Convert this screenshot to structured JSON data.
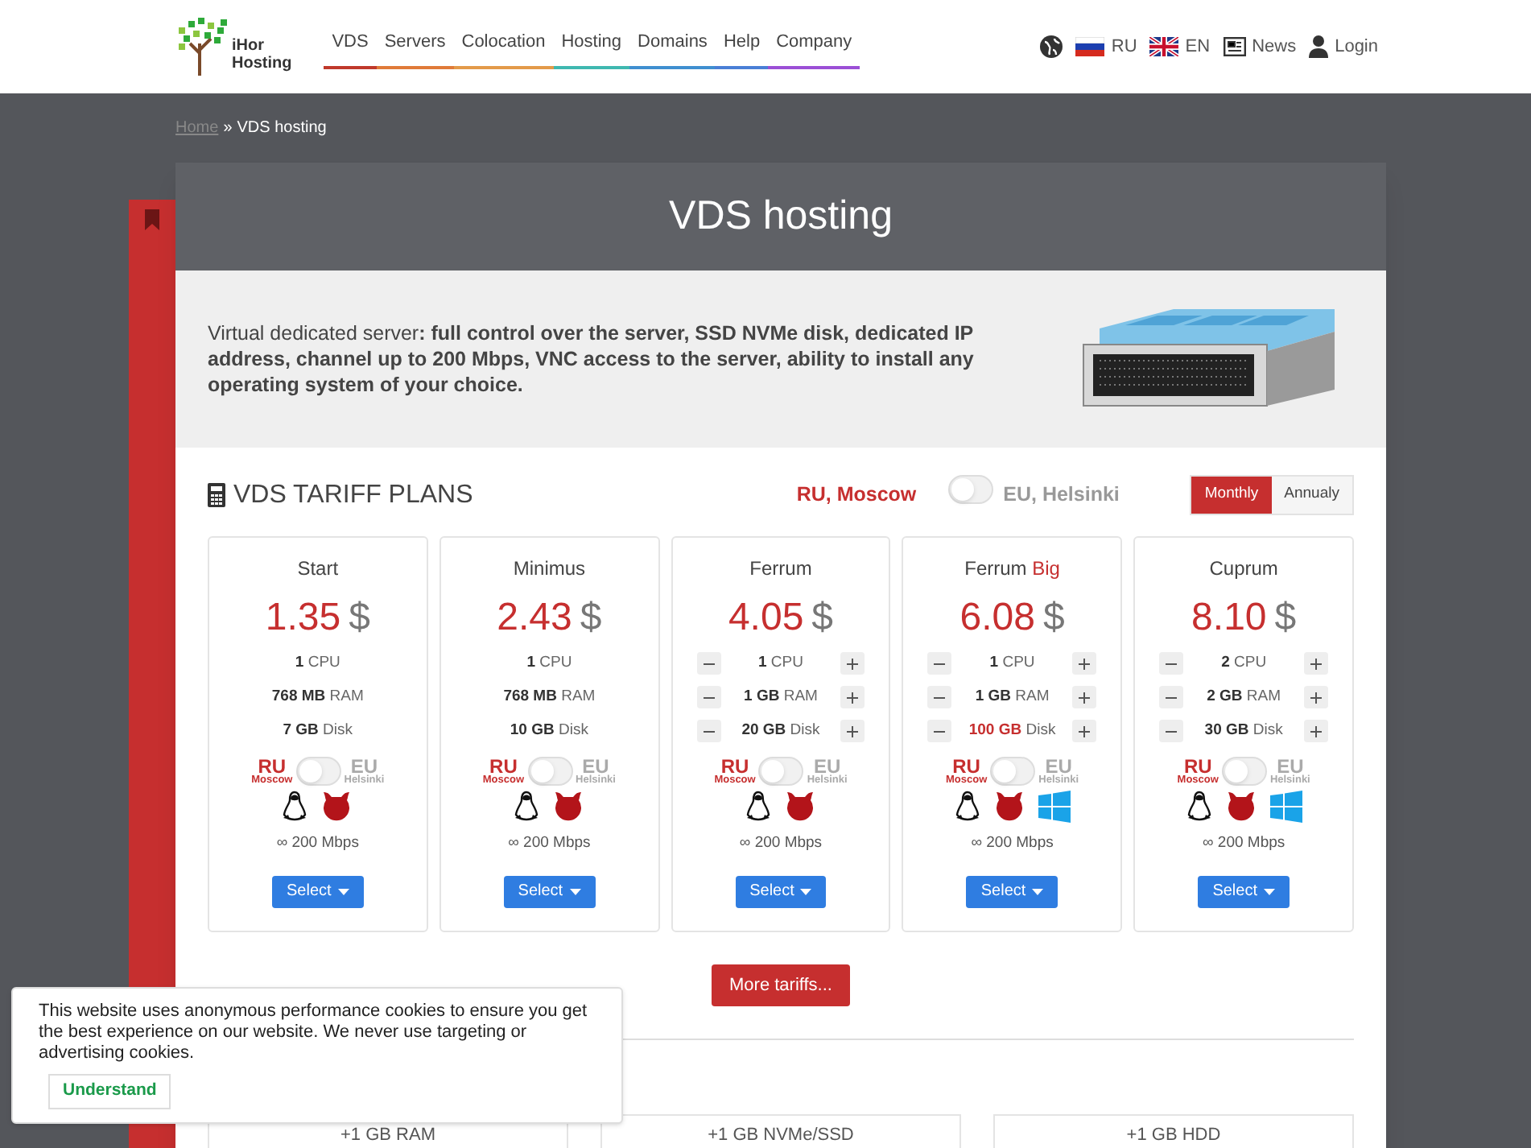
{
  "header": {
    "logo_text": [
      "iHor",
      "Hosting"
    ],
    "nav": [
      {
        "label": "VDS",
        "color": "#c0392b"
      },
      {
        "label": "Servers",
        "color": "#e07b39"
      },
      {
        "label": "Colocation",
        "color": "#e39a4a"
      },
      {
        "label": "Hosting",
        "color": "#3fb8b0"
      },
      {
        "label": "Domains",
        "color": "#3f8fd0"
      },
      {
        "label": "Help",
        "color": "#4a7fd6"
      },
      {
        "label": "Company",
        "color": "#9b4fd6"
      }
    ],
    "languages": [
      {
        "kind": "ru",
        "label": "RU"
      },
      {
        "kind": "en",
        "label": "EN"
      }
    ],
    "news": "News",
    "login": "Login"
  },
  "breadcrumb": {
    "link": "Home",
    "separator": "»",
    "current": "VDS hosting"
  },
  "page_title": "VDS hosting",
  "intro": "Virtual dedicated server**: full control over the server, SSD NVMe disk, dedicated IP address, channel up to 200 Mbps, VNC access to the server, ability to install any operating system of your choice.**",
  "tariffs": {
    "title": "VDS TARIFF PLANS",
    "location_left": "RU, Moscow",
    "location_right": "EU, Helsinki",
    "location_on": false,
    "billing": [
      {
        "label": "Monthly",
        "selected": true
      },
      {
        "label": "Annualy",
        "selected": false
      }
    ],
    "plans": [
      {
        "name": "Start",
        "price": "1.35",
        "currency": "$",
        "adjustable": false,
        "specs": [
          {
            "value": "1",
            "unit": "CPU",
            "highlight": false
          },
          {
            "value": "768 MB",
            "unit": "RAM",
            "highlight": false
          },
          {
            "value": "7 GB",
            "unit": "Disk",
            "highlight": false
          }
        ],
        "location": {
          "left": "RU",
          "left_sub": "Moscow",
          "right": "EU",
          "right_sub": "Helsinki",
          "on": false
        },
        "os": [
          {
            "kind": "linux"
          },
          {
            "kind": "freebsd"
          }
        ],
        "speed": "∞ 200 Mbps",
        "button": "Select"
      },
      {
        "name": "Minimus",
        "price": "2.43",
        "currency": "$",
        "adjustable": false,
        "specs": [
          {
            "value": "1",
            "unit": "CPU",
            "highlight": false
          },
          {
            "value": "768 MB",
            "unit": "RAM",
            "highlight": false
          },
          {
            "value": "10 GB",
            "unit": "Disk",
            "highlight": false
          }
        ],
        "location": {
          "left": "RU",
          "left_sub": "Moscow",
          "right": "EU",
          "right_sub": "Helsinki",
          "on": false
        },
        "os": [
          {
            "kind": "linux"
          },
          {
            "kind": "freebsd"
          }
        ],
        "speed": "∞ 200 Mbps",
        "button": "Select"
      },
      {
        "name": "Ferrum",
        "price": "4.05",
        "currency": "$",
        "adjustable": true,
        "specs": [
          {
            "value": "1",
            "unit": "CPU",
            "highlight": false
          },
          {
            "value": "1 GB",
            "unit": "RAM",
            "highlight": false
          },
          {
            "value": "20 GB",
            "unit": "Disk",
            "highlight": false
          }
        ],
        "location": {
          "left": "RU",
          "left_sub": "Moscow",
          "right": "EU",
          "right_sub": "Helsinki",
          "on": false
        },
        "os": [
          {
            "kind": "linux"
          },
          {
            "kind": "freebsd"
          }
        ],
        "speed": "∞ 200 Mbps",
        "button": "Select"
      },
      {
        "name": "Ferrum",
        "name_suffix": "Big",
        "price": "6.08",
        "currency": "$",
        "adjustable": true,
        "specs": [
          {
            "value": "1",
            "unit": "CPU",
            "highlight": false
          },
          {
            "value": "1 GB",
            "unit": "RAM",
            "highlight": false
          },
          {
            "value": "100 GB",
            "unit": "Disk",
            "highlight": true
          }
        ],
        "location": {
          "left": "RU",
          "left_sub": "Moscow",
          "right": "EU",
          "right_sub": "Helsinki",
          "on": false
        },
        "os": [
          {
            "kind": "linux"
          },
          {
            "kind": "freebsd"
          },
          {
            "kind": "windows"
          }
        ],
        "speed": "∞ 200 Mbps",
        "button": "Select"
      },
      {
        "name": "Cuprum",
        "price": "8.10",
        "currency": "$",
        "adjustable": true,
        "specs": [
          {
            "value": "2",
            "unit": "CPU",
            "highlight": false
          },
          {
            "value": "2 GB",
            "unit": "RAM",
            "highlight": false
          },
          {
            "value": "30 GB",
            "unit": "Disk",
            "highlight": false
          }
        ],
        "location": {
          "left": "RU",
          "left_sub": "Moscow",
          "right": "EU",
          "right_sub": "Helsinki",
          "on": false
        },
        "os": [
          {
            "kind": "linux"
          },
          {
            "kind": "freebsd"
          },
          {
            "kind": "windows"
          }
        ],
        "speed": "∞ 200 Mbps",
        "button": "Select"
      }
    ],
    "more_button": "More tariffs..."
  },
  "additions": {
    "items": [
      "+1 GB RAM",
      "+1 GB NVMe/SSD",
      "+1 GB HDD"
    ]
  },
  "cookie_banner": {
    "text": "This website uses anonymous performance cookies to ensure you get the best experience on our website. We never use targeting or advertising cookies.",
    "button": "Understand"
  }
}
